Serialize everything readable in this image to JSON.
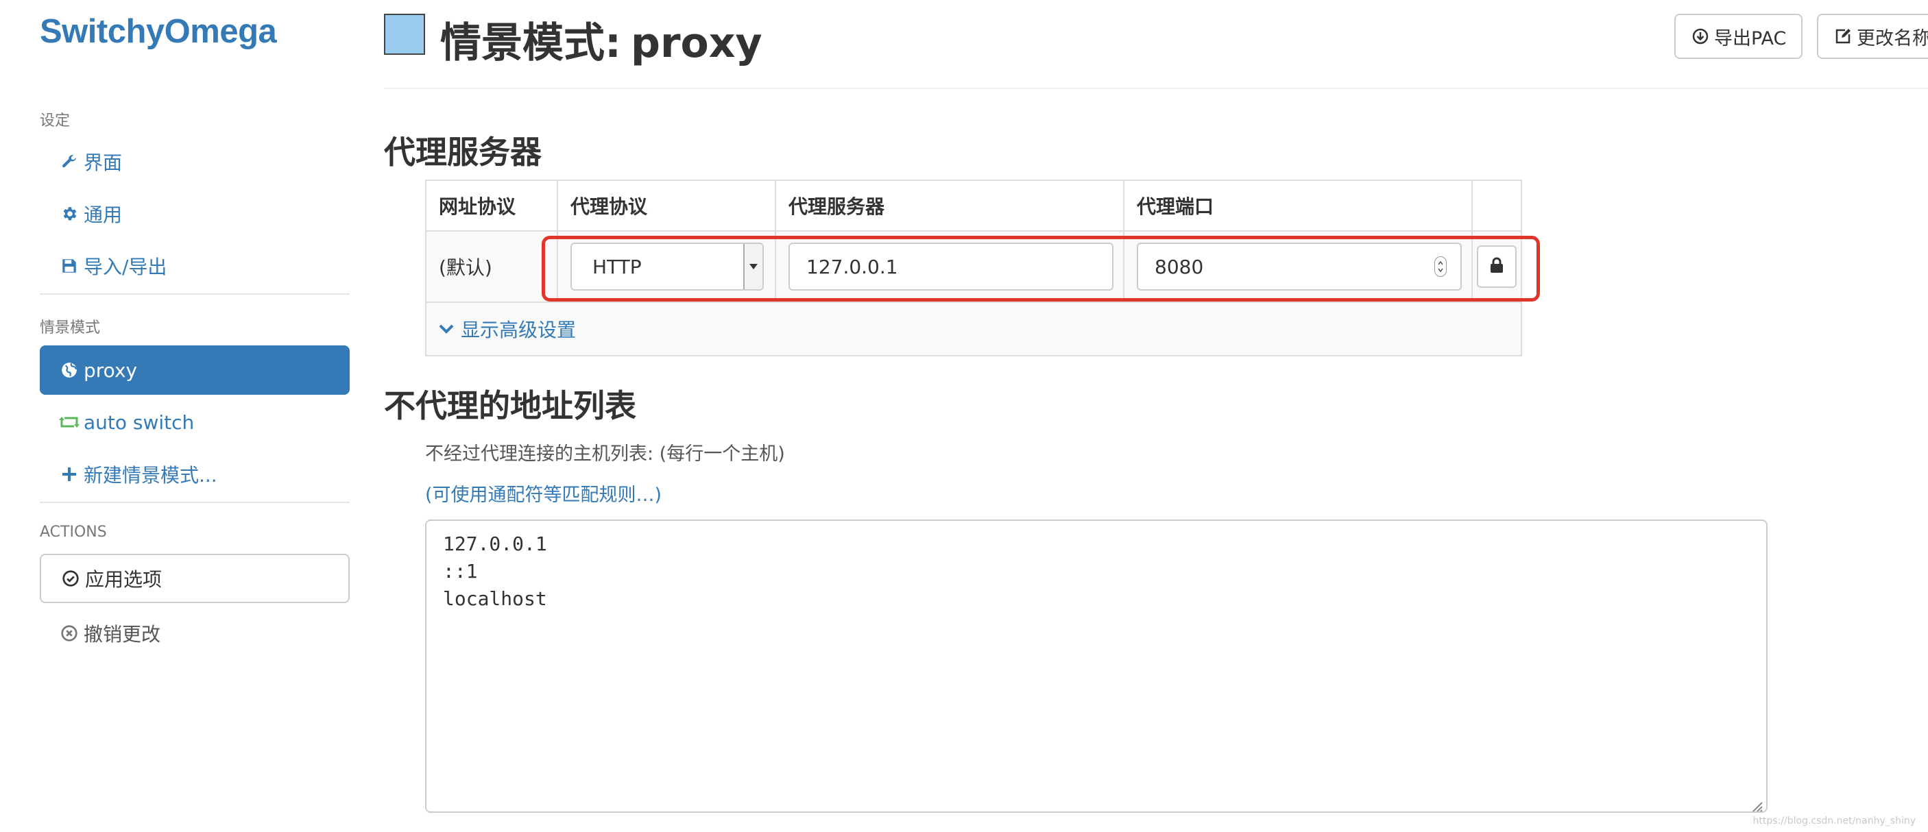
{
  "sidebar": {
    "brand": "SwitchyOmega",
    "settings_header": "设定",
    "settings_items": [
      {
        "label": "界面",
        "icon": "wrench-icon"
      },
      {
        "label": "通用",
        "icon": "gear-icon"
      },
      {
        "label": "导入/导出",
        "icon": "floppy-icon"
      }
    ],
    "profiles_header": "情景模式",
    "profiles": [
      {
        "label": "proxy",
        "icon": "globe-icon",
        "active": true
      },
      {
        "label": "auto switch",
        "icon": "retweet-icon",
        "active": false
      },
      {
        "label": "新建情景模式...",
        "icon": "plus-icon",
        "active": false
      }
    ],
    "actions_header": "ACTIONS",
    "actions": [
      {
        "label": "应用选项",
        "icon": "check-circle-icon"
      },
      {
        "label": "撤销更改",
        "icon": "times-circle-icon"
      }
    ]
  },
  "header": {
    "title_prefix": "情景模式:",
    "profile_name": "proxy",
    "profile_color": "#99ccee",
    "export_pac_label": "导出PAC",
    "rename_label": "更改名称"
  },
  "proxy_servers": {
    "section_title": "代理服务器",
    "columns": [
      "网址协议",
      "代理协议",
      "代理服务器",
      "代理端口"
    ],
    "row": {
      "scheme": "(默认)",
      "protocol": "HTTP",
      "server": "127.0.0.1",
      "port": "8080"
    },
    "advanced_label": "显示高级设置"
  },
  "bypass": {
    "section_title": "不代理的地址列表",
    "help_text": "不经过代理连接的主机列表: (每行一个主机)",
    "help_link": "(可使用通配符等匹配规则…)",
    "list_text": "127.0.0.1\n::1\nlocalhost"
  },
  "watermark": "https://blog.csdn.net/nanhy_shiny",
  "colors": {
    "accent": "#337ab7",
    "highlight": "#e0352b",
    "auto_switch_icon": "#5cb85c"
  }
}
